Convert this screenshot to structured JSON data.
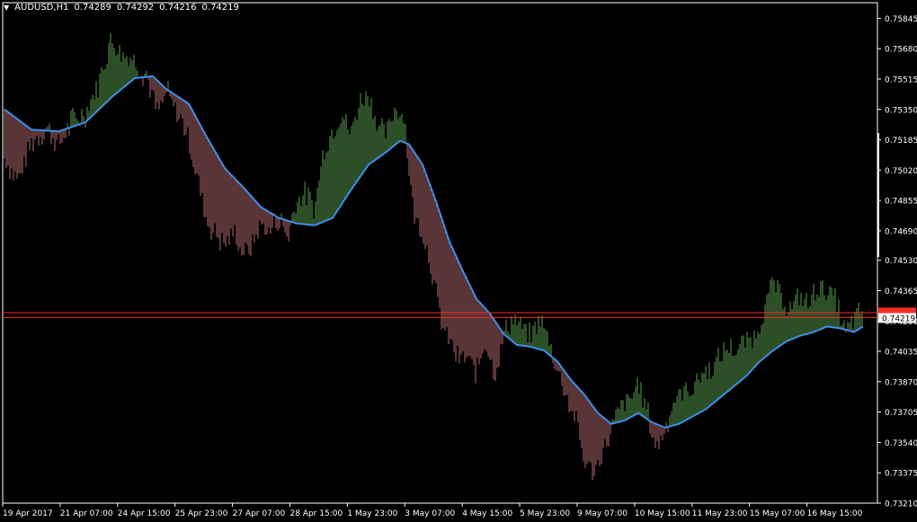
{
  "header": {
    "symbol": "AUDUSD,H1",
    "open": "0.74289",
    "high": "0.74292",
    "low": "0.74216",
    "close": "0.74219"
  },
  "colors": {
    "background": "#000000",
    "bull_bar": "#5a9e4e",
    "bear_bar": "#b46a6e",
    "moving_average": "#3f8fe8",
    "price_line": "#ff2a2a",
    "current_price_label_bg": "#ffffff",
    "axis_text": "#ffffff"
  },
  "chart_data": {
    "type": "line",
    "instrument": "AUDUSD",
    "timeframe": "H1",
    "y_ticks": [
      "0.75845",
      "0.75680",
      "0.75515",
      "0.75350",
      "0.75185",
      "0.75020",
      "0.74855",
      "0.74690",
      "0.74530",
      "0.74365",
      "0.74200",
      "0.74035",
      "0.73870",
      "0.73705",
      "0.73540",
      "0.73375",
      "0.73210"
    ],
    "x_ticks": [
      "19 Apr 2017",
      "21 Apr 07:00",
      "24 Apr 15:00",
      "25 Apr 23:00",
      "27 Apr 07:00",
      "28 Apr 15:00",
      "1 May 23:00",
      "3 May 07:00",
      "4 May 15:00",
      "5 May 23:00",
      "9 May 07:00",
      "10 May 15:00",
      "11 May 23:00",
      "15 May 07:00",
      "16 May 15:00"
    ],
    "ylim": [
      0.7321,
      0.7593
    ],
    "current_price": "0.74219",
    "price_lines": [
      0.74245,
      0.74219
    ],
    "price_path": {
      "x": [
        0,
        15,
        30,
        45,
        60,
        75,
        90,
        105,
        118,
        130,
        145,
        160,
        170,
        180,
        195,
        205,
        215,
        225,
        235,
        245,
        255,
        265,
        275,
        285,
        295,
        305,
        315,
        325,
        335,
        345,
        355,
        365,
        375,
        385,
        395,
        405,
        415,
        425,
        435,
        445,
        455,
        465,
        475,
        485,
        495,
        505,
        515,
        525,
        535,
        545,
        555,
        565,
        575,
        585,
        595,
        605,
        615,
        625,
        635,
        645,
        655,
        665,
        675,
        685,
        695,
        705,
        715,
        725,
        735,
        745,
        755,
        765,
        775,
        785,
        795,
        805,
        815,
        825,
        835,
        845,
        855,
        865,
        875,
        885,
        895,
        905,
        915,
        925,
        935,
        945,
        955
      ],
      "y": [
        0.751,
        0.7497,
        0.7518,
        0.7525,
        0.7517,
        0.7528,
        0.7532,
        0.7548,
        0.7572,
        0.7565,
        0.756,
        0.7552,
        0.7535,
        0.7545,
        0.7532,
        0.752,
        0.7498,
        0.7475,
        0.7468,
        0.7462,
        0.7471,
        0.7458,
        0.7462,
        0.7474,
        0.747,
        0.7476,
        0.7466,
        0.7485,
        0.7488,
        0.748,
        0.7512,
        0.7522,
        0.7532,
        0.752,
        0.7538,
        0.7543,
        0.7525,
        0.752,
        0.7535,
        0.753,
        0.7478,
        0.747,
        0.745,
        0.7422,
        0.741,
        0.74,
        0.7402,
        0.7393,
        0.741,
        0.7392,
        0.7412,
        0.742,
        0.7415,
        0.741,
        0.742,
        0.741,
        0.7395,
        0.738,
        0.7368,
        0.7345,
        0.734,
        0.735,
        0.736,
        0.7372,
        0.7375,
        0.7385,
        0.737,
        0.7352,
        0.7362,
        0.7375,
        0.738,
        0.7382,
        0.739,
        0.7392,
        0.7398,
        0.7405,
        0.7402,
        0.7408,
        0.741,
        0.7425,
        0.744,
        0.743,
        0.7425,
        0.7432,
        0.7428,
        0.7438,
        0.7435,
        0.743,
        0.7412,
        0.742,
        0.7425
      ]
    },
    "moving_average": {
      "x": [
        0,
        30,
        60,
        90,
        120,
        145,
        165,
        180,
        205,
        225,
        245,
        265,
        285,
        305,
        325,
        345,
        365,
        385,
        405,
        425,
        440,
        450,
        465,
        480,
        495,
        510,
        525,
        540,
        555,
        570,
        585,
        600,
        615,
        630,
        645,
        660,
        675,
        690,
        705,
        720,
        735,
        750,
        765,
        780,
        795,
        810,
        825,
        840,
        855,
        870,
        885,
        900,
        915,
        930,
        945,
        955
      ],
      "y": [
        0.7535,
        0.7524,
        0.7523,
        0.7528,
        0.7542,
        0.7552,
        0.7553,
        0.7546,
        0.7538,
        0.752,
        0.7503,
        0.7493,
        0.7482,
        0.7476,
        0.7473,
        0.7472,
        0.7476,
        0.7491,
        0.7505,
        0.7512,
        0.7518,
        0.7516,
        0.7505,
        0.7485,
        0.7463,
        0.7447,
        0.7432,
        0.7424,
        0.7413,
        0.7407,
        0.7406,
        0.7404,
        0.7398,
        0.7388,
        0.738,
        0.737,
        0.7364,
        0.7366,
        0.737,
        0.7365,
        0.7362,
        0.7364,
        0.7368,
        0.7372,
        0.7378,
        0.7384,
        0.739,
        0.7398,
        0.7404,
        0.7409,
        0.7412,
        0.7414,
        0.7417,
        0.7416,
        0.7414,
        0.7417
      ]
    },
    "grid": false
  }
}
